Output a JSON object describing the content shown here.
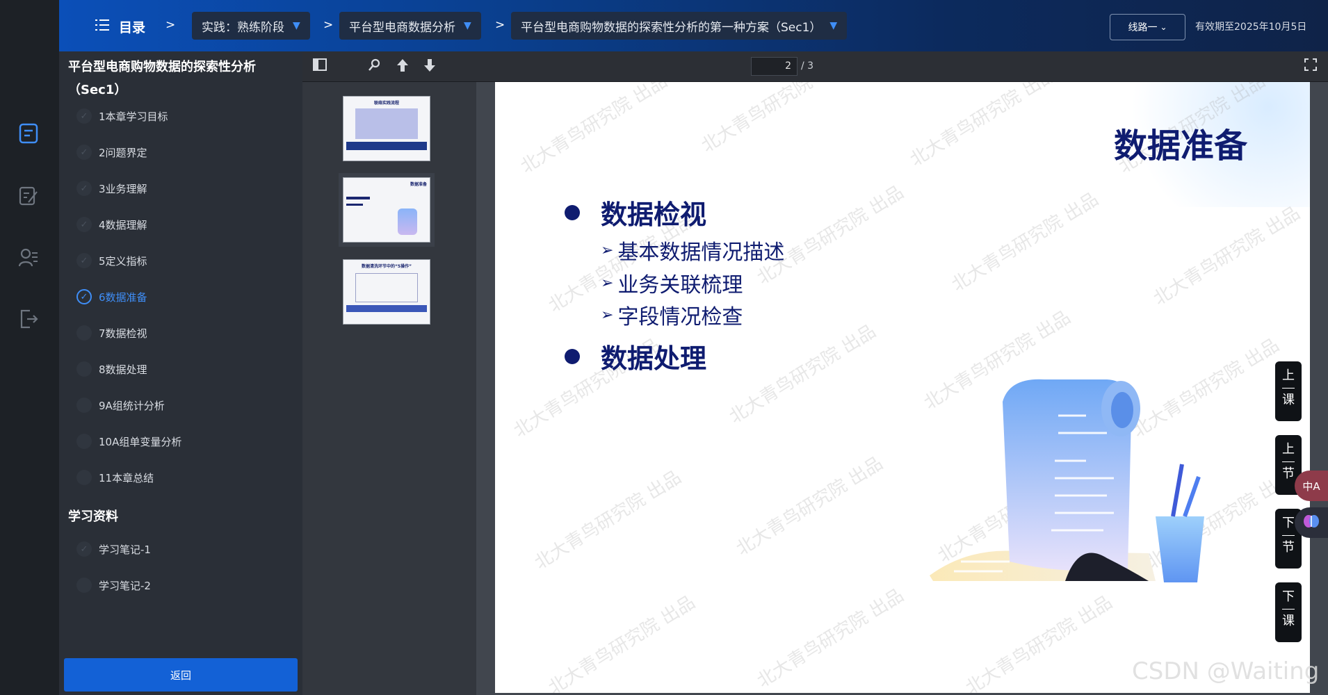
{
  "topbar": {
    "menu_label": "目录",
    "separators": [
      ">",
      ">",
      ">"
    ],
    "crumbs": [
      "实践：熟练阶段",
      "平台型电商数据分析",
      "平台型电商购物数据的探索性分析的第一种方案（Sec1）"
    ],
    "route_label": "线路一",
    "expiry": "有效期至2025年10月5日"
  },
  "sidebar": {
    "title": "平台型电商购物数据的探索性分析（Sec1）",
    "items": [
      {
        "label": "1本章学习目标",
        "checked": true
      },
      {
        "label": "2问题界定",
        "checked": true
      },
      {
        "label": "3业务理解",
        "checked": true
      },
      {
        "label": "4数据理解",
        "checked": true
      },
      {
        "label": "5定义指标",
        "checked": true
      },
      {
        "label": "6数据准备",
        "checked": true,
        "active": true
      },
      {
        "label": "7数据检视",
        "checked": false
      },
      {
        "label": "8数据处理",
        "checked": false
      },
      {
        "label": "9A组统计分析",
        "checked": false
      },
      {
        "label": "10A组单变量分析",
        "checked": false
      },
      {
        "label": "11本章总结",
        "checked": false
      }
    ],
    "materials_title": "学习资料",
    "materials": [
      {
        "label": "学习笔记-1",
        "checked": true
      },
      {
        "label": "学习笔记-2",
        "checked": false
      }
    ],
    "back_label": "返回"
  },
  "viewer": {
    "current_page": "2",
    "total_pages": "/ 3",
    "thumbnails": [
      "联络实践流程",
      "数据准备",
      "数据清洗环节中的“5操作”"
    ]
  },
  "slide": {
    "title": "数据准备",
    "bullets": [
      {
        "label": "数据检视",
        "subs": [
          "基本数据情况描述",
          "业务关联梳理",
          "字段情况检查"
        ]
      },
      {
        "label": "数据处理",
        "subs": []
      }
    ],
    "watermark": "北大青鸟研究院 出品"
  },
  "float_nav": [
    {
      "top": "上",
      "bottom": "课"
    },
    {
      "top": "上",
      "bottom": "节"
    },
    {
      "top": "下",
      "bottom": "节"
    },
    {
      "top": "下",
      "bottom": "课"
    }
  ],
  "translate_bubble": "中A",
  "csdn_mark": "CSDN @Waiting"
}
